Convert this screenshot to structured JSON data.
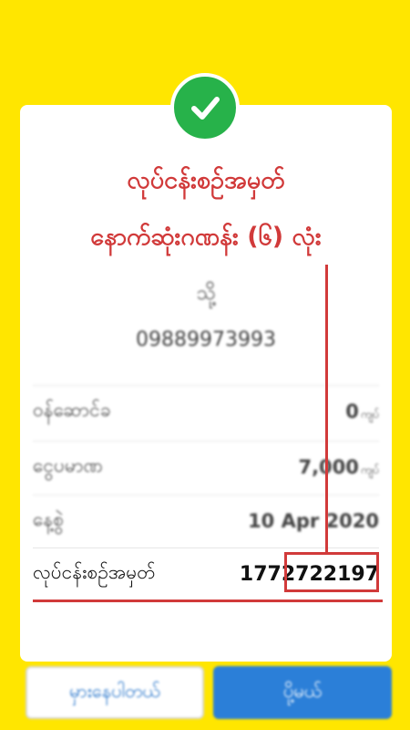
{
  "annotation": {
    "line1": "လုပ်ငန်းစဉ်အမှတ်",
    "line2": "နောက်ဆုံးဂဏန်း (၆) လုံး"
  },
  "recipient": {
    "name": "သို့",
    "phone": "09889973993"
  },
  "details": {
    "fee_label": "ဝန်ဆောင်ခ",
    "fee_value": "0",
    "fee_unit": "ကျပ်",
    "amount_label": "ငွေပမာဏ",
    "amount_value": "7,000",
    "amount_unit": "ကျပ်",
    "date_label": "နေ့စွဲ",
    "date_value": "10 Apr 2020",
    "txn_label": "လုပ်ငန်းစဉ်အမှတ်",
    "txn_value": "1772722197"
  },
  "buttons": {
    "secondary_label": "မှားနေပါတယ်",
    "primary_label": "ပို့မယ်"
  },
  "colors": {
    "background": "#FFE600",
    "success": "#27B24A",
    "annotation": "#D13A3A",
    "primary_button": "#2B7FD8"
  },
  "icons": {
    "status": "check-icon"
  }
}
